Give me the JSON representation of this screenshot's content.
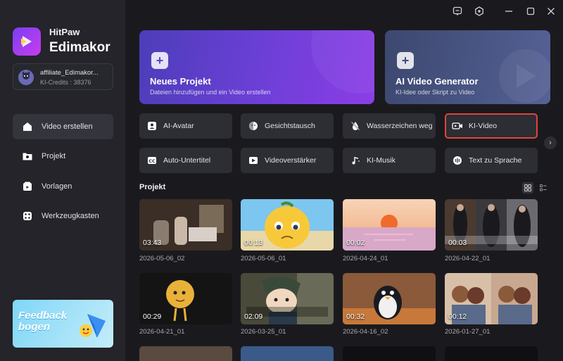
{
  "app": {
    "brand_line1": "HitPaw",
    "brand_line2": "Edimakor"
  },
  "account": {
    "name": "affiliate_Edimakor...",
    "credits": "KI-Credits : 38376"
  },
  "nav": [
    {
      "label": "Video erstellen",
      "icon": "home-icon",
      "active": true
    },
    {
      "label": "Projekt",
      "icon": "folder-icon"
    },
    {
      "label": "Vorlagen",
      "icon": "template-icon"
    },
    {
      "label": "Werkzeugkasten",
      "icon": "toolbox-icon"
    }
  ],
  "feedback": {
    "line1": "Feedback",
    "line2": "bogen"
  },
  "hero": {
    "new_project": {
      "title": "Neues Projekt",
      "subtitle": "Dateien hinzufügen und ein Video erstellen"
    },
    "ai_video": {
      "title": "AI Video Generator",
      "subtitle": "KI-Idee oder Skript zu Video"
    }
  },
  "tools": [
    {
      "label": "AI-Avatar",
      "icon": "avatar-icon"
    },
    {
      "label": "Gesichtstausch",
      "icon": "face-swap-icon"
    },
    {
      "label": "Wasserzeichen weg",
      "icon": "watermark-remove-icon"
    },
    {
      "label": "KI-Video",
      "icon": "ai-video-icon",
      "highlighted": true
    },
    {
      "label": "Auto-Untertitel",
      "icon": "subtitle-icon"
    },
    {
      "label": "Videoverstärker",
      "icon": "video-enhancer-icon"
    },
    {
      "label": "KI-Musik",
      "icon": "music-icon"
    },
    {
      "label": "Text zu Sprache",
      "icon": "text-to-speech-icon"
    }
  ],
  "projects": {
    "title": "Projekt",
    "items": [
      {
        "duration": "03:43",
        "name": "2026-05-06_02"
      },
      {
        "duration": "00:13",
        "name": "2026-05-06_01"
      },
      {
        "duration": "00:02",
        "name": "2026-04-24_01"
      },
      {
        "duration": "00:03",
        "name": "2026-04-22_01"
      },
      {
        "duration": "00:29",
        "name": "2026-04-21_01"
      },
      {
        "duration": "02:09",
        "name": "2026-03-25_01"
      },
      {
        "duration": "00:32",
        "name": "2026-04-16_02"
      },
      {
        "duration": "00:12",
        "name": "2026-01-27_01"
      }
    ]
  },
  "colors": {
    "accent": "#6b3fd6",
    "highlight_border": "#e0453a"
  }
}
